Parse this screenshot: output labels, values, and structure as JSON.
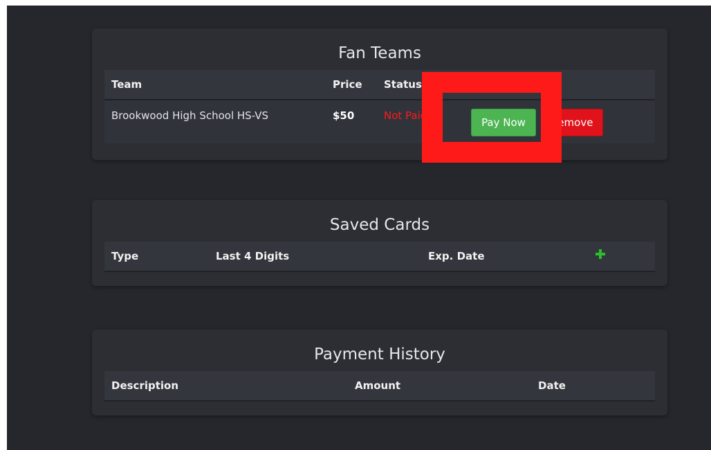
{
  "fan_teams": {
    "title": "Fan Teams",
    "columns": [
      "Team",
      "Price",
      "Status"
    ],
    "rows": [
      {
        "team": "Brookwood High School HS-VS",
        "price": "$50",
        "status": "Not Paid",
        "pay_label": "Pay Now",
        "remove_label": "Remove"
      }
    ]
  },
  "saved_cards": {
    "title": "Saved Cards",
    "columns": [
      "Type",
      "Last 4 Digits",
      "Exp. Date"
    ],
    "add_icon": "plus-icon"
  },
  "payment_history": {
    "title": "Payment History",
    "columns": [
      "Description",
      "Amount",
      "Date"
    ]
  },
  "colors": {
    "status_unpaid": "#ff1a1a",
    "pay_button": "#4cb552",
    "remove_button": "#e0121b",
    "highlight": "#ff1a1a",
    "add_icon": "#2cbf2c"
  }
}
